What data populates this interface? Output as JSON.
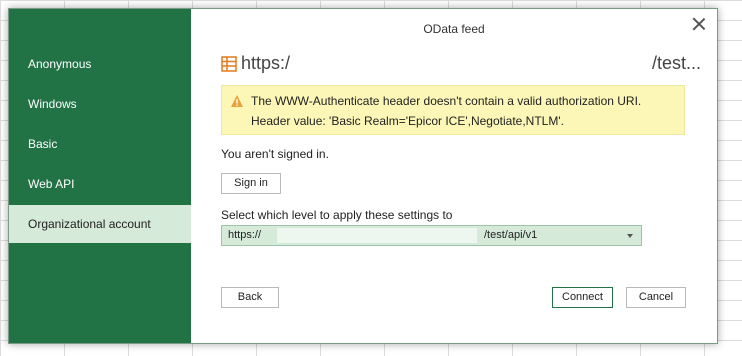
{
  "dialog": {
    "title": "OData feed",
    "sidebar": {
      "items": [
        {
          "label": "Anonymous"
        },
        {
          "label": "Windows"
        },
        {
          "label": "Basic"
        },
        {
          "label": "Web API"
        },
        {
          "label": "Organizational account",
          "selected": true
        }
      ]
    },
    "url": {
      "prefix": "https:/",
      "suffix": "/test..."
    },
    "warning": {
      "line1": "The WWW-Authenticate header doesn't contain a valid authorization URI.",
      "line2": "Header value: 'Basic Realm='Epicor ICE',Negotiate,NTLM'."
    },
    "status_text": "You aren't signed in.",
    "sign_in_label": "Sign in",
    "level": {
      "label": "Select which level to apply these settings to",
      "value_prefix": "https://",
      "value_suffix": "/test/api/v1"
    },
    "buttons": {
      "back": "Back",
      "connect": "Connect",
      "cancel": "Cancel"
    }
  },
  "colors": {
    "accent": "#217346",
    "selected_bg": "#d5ead9",
    "warning_bg": "#fcf7b6"
  },
  "icons": {
    "close": "close-icon",
    "feed": "odata-feed-icon",
    "warning": "warning-icon",
    "dropdown": "chevron-down-icon"
  }
}
